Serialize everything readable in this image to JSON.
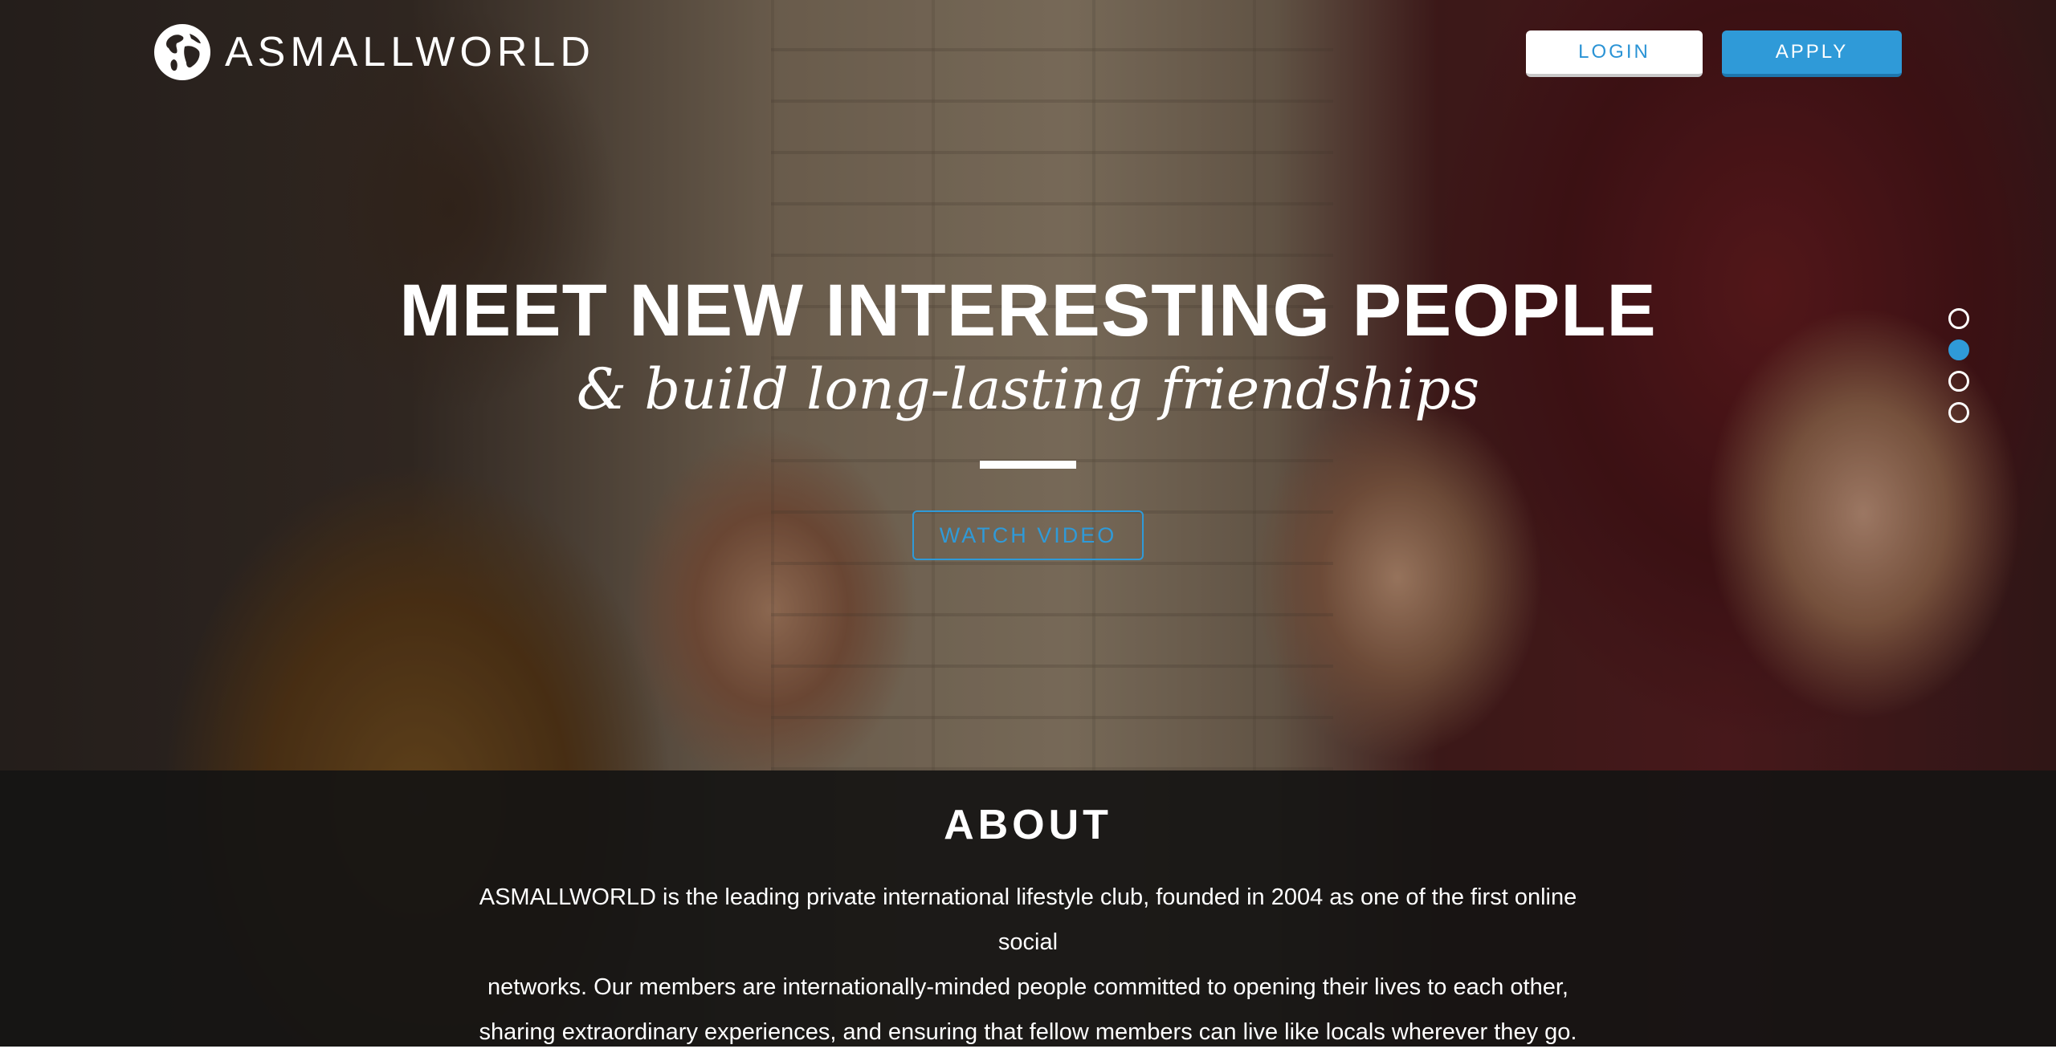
{
  "header": {
    "brand": "ASMALLWORLD",
    "logo_icon": "globe-icon",
    "login_label": "LOGIN",
    "apply_label": "APPLY"
  },
  "hero": {
    "headline": "MEET NEW INTERESTING PEOPLE",
    "subline": "& build long-lasting friendships",
    "watch_label": "WATCH VIDEO",
    "slides_total": 4,
    "active_slide": 2
  },
  "about": {
    "title": "ABOUT",
    "lines": [
      "ASMALLWORLD is the leading private international lifestyle club, founded in 2004 as one of the first online social",
      "networks. Our members are internationally-minded people committed to opening their lives to each other,",
      "sharing extraordinary experiences, and ensuring that fellow members can live like locals wherever they go."
    ]
  },
  "colors": {
    "accent": "#2f9ad8",
    "about_band": "#161413",
    "text": "#ffffff"
  }
}
